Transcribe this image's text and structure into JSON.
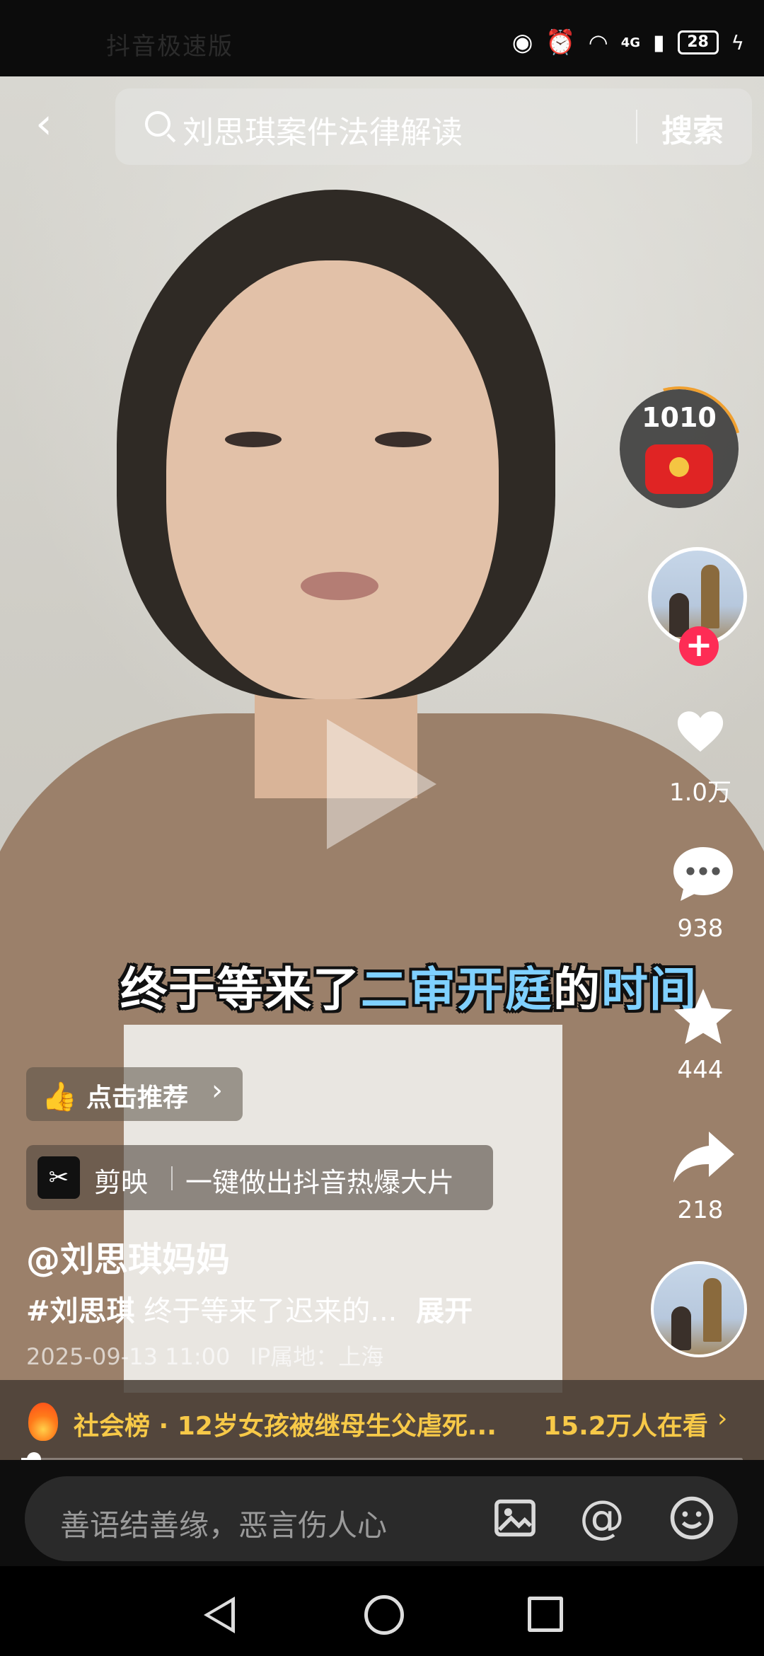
{
  "status_bar": {
    "left_text": "抖音极速版",
    "network": "4G",
    "battery": "28"
  },
  "search": {
    "placeholder": "刘思琪案件法律解读",
    "button": "搜索"
  },
  "video": {
    "caption_part1": "终于等来了",
    "caption_part2": "二审开庭",
    "caption_part3": "的",
    "caption_part4": "时间"
  },
  "sidebar": {
    "red_packet_count": "1010",
    "likes": "1.0万",
    "comments": "938",
    "favorites": "444",
    "shares": "218"
  },
  "recommend": {
    "label": "点击推荐",
    "chevron": "›"
  },
  "promo": {
    "logo": "✂",
    "app_name": "剪映",
    "slogan": "一键做出抖音热爆大片"
  },
  "post": {
    "author": "@刘思琪妈妈",
    "hashtag": "#刘思琪",
    "text": "终于等来了迟来的...",
    "expand": "展开",
    "timestamp": "2025-09-13 11:00",
    "ip": "IP属地：上海"
  },
  "hot": {
    "text": "社会榜 · 12岁女孩被继母生父虐死...",
    "viewers": "15.2万人在看",
    "chevron": "›"
  },
  "comment_bar": {
    "placeholder": "善语结善缘，恶言伤人心",
    "at_symbol": "@"
  },
  "colors": {
    "accent_red": "#fe2c55",
    "hot_yellow": "#f7c948",
    "caption_highlight": "#7fd0ff"
  },
  "icons": [
    "back-icon",
    "search-icon",
    "red-packet-icon",
    "heart-icon",
    "comment-icon",
    "star-icon",
    "share-icon",
    "thumb-icon",
    "image-icon",
    "at-icon",
    "emoji-icon",
    "fire-icon"
  ]
}
